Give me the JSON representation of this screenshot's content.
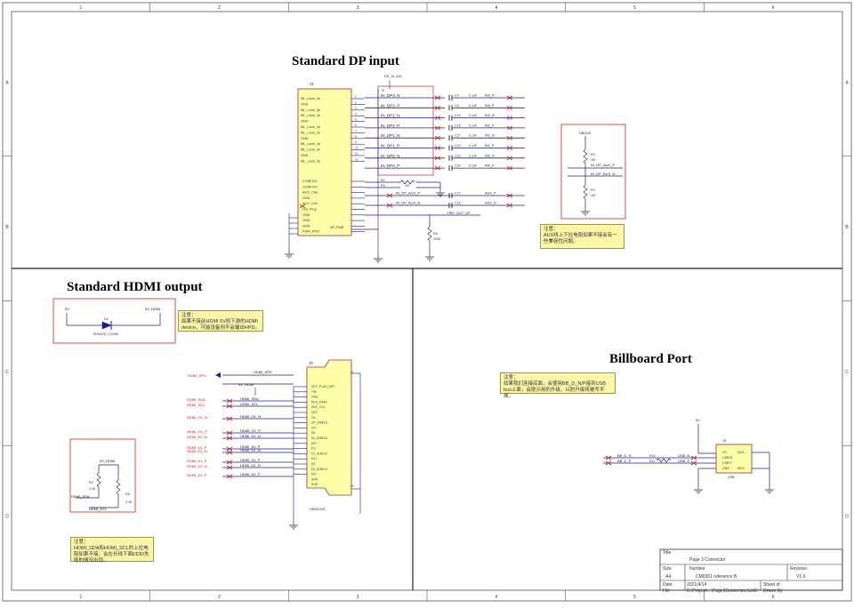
{
  "border_cols": [
    "1",
    "2",
    "3",
    "4",
    "5",
    "6"
  ],
  "border_rows": [
    "A",
    "B",
    "C",
    "D"
  ],
  "sections": {
    "dp": {
      "title": "Standard DP input",
      "connector_ref": "J1",
      "top_net": "DP_In_Det",
      "diff_label": "A",
      "pins_left": [
        "ML_Lane_3n",
        "GND",
        "ML_Lane_3p",
        "ML_Lane_2n",
        "GND",
        "ML_Lane_2p",
        "ML_Lane_1n",
        "GND",
        "ML_Lane_1p",
        "ML_Lane_0n",
        "GND",
        "ML_Lane_0p"
      ],
      "pins_num": [
        "1",
        "2",
        "3",
        "4",
        "5",
        "6",
        "7",
        "8",
        "9",
        "10",
        "11",
        "12"
      ],
      "nets": [
        "IN_DP3_N",
        "IN_DP3_P",
        "IN_DP2_N",
        "IN_DP2_P",
        "IN_DP1_N",
        "IN_DP1_P",
        "IN_DP0_N",
        "IN_DP0_P"
      ],
      "caps": [
        "C4",
        "C3",
        "C19",
        "C18",
        "C27",
        "C24",
        "C23",
        "C20"
      ],
      "cap_values": [
        "0.1uF",
        "0.1uF",
        "0.1uF",
        "0.1uF",
        "0.1uF",
        "0.1uF",
        "0.1uF",
        "0.1uF"
      ],
      "out_nets": [
        "IN3_N",
        "IN3_P",
        "IN2_N",
        "IN2_P",
        "IN1_N",
        "IN1_P",
        "IN0_N",
        "IN0_P"
      ],
      "cfg_pins": [
        "CONFIG1",
        "CONFIG2",
        "AUX_CHp",
        "GND",
        "AUX_CHn",
        "Hot_Plug",
        "GND",
        "GND",
        "GND",
        "PWR_RTN"
      ],
      "aux_nets": [
        "IN_DP_AUX_P",
        "IN_DP_AUX_N",
        "HPD_OUT_DP",
        "DP_PWR"
      ],
      "aux_caps": [
        "C17",
        "C16"
      ],
      "aux_out": [
        "AUX_P",
        "AUX_N"
      ],
      "r_refs": [
        "R4",
        "R5",
        "R6"
      ],
      "r_values": [
        "1M",
        "1M",
        "100K"
      ],
      "aux_box": {
        "net": "VBUS3",
        "r1": "R3",
        "r2": "R3",
        "v1": "1M",
        "v2": "1M",
        "n1": "IN_DP_AUX_P",
        "n2": "IN_DP_AUX_N"
      },
      "note": "注意：\nAUX线上下拉电阻如果不接会有一些兼容性问题。"
    },
    "hdmi": {
      "title": "Standard HDMI output",
      "rail_in": "5V",
      "rail_out": "5V_HDMI",
      "diode_ref": "D4",
      "diode_part": "BSS0HS_CG058",
      "note_top": "注意：\n如果不接此HDMI 5V则下游的HDMI device，可能设备则不会输出HPD。",
      "connector_ref": "J4",
      "connector_part": "HDMI-019",
      "hpd_net": "HDMI_HPD",
      "nets_left": [
        "HDMI_HPD",
        "5V_HDMI",
        "HDMI_SDA",
        "HDMI_SCL",
        "HDMI_CK_N",
        "HDMI_CK_P",
        "HDMI_D0_N",
        "HDMI_D0_P",
        "HDMI_D1_N",
        "HDMI_D1_P",
        "HDMI_D2_N",
        "HDMI_D2_P"
      ],
      "pins": [
        "HOT_PLUG_DET",
        "+5V",
        "GND",
        "DDC_DATA",
        "DDC_CLK",
        "CEC",
        "CK-",
        "CK_SHIELD",
        "CK+",
        "D0-",
        "D0_SHIELD",
        "D0+",
        "D1-",
        "D1_SHIELD",
        "D1+",
        "D2-",
        "D2_SHIELD",
        "D2+",
        "SHD",
        "SHD"
      ],
      "pull_box": {
        "rail": "5V_HDMI",
        "r1": "R9",
        "r2": "R8",
        "v1": "3.3K",
        "v2": "3.3K",
        "n1": "HDMI_SDA",
        "n2": "HDMI_SCL"
      },
      "note_bottom": "注意：\nHDMI_SDA和HDMI_SCL的上拉电阻如果不接，会在长线下面EDID失败的情况出现。"
    },
    "billboard": {
      "title": "Billboard Port",
      "note": "注意：\n如果我们连接底面，会使用BB_D_N/P接到USB bus上面，会提示用的升级，以防升级将被写不掉。",
      "rail": "5V",
      "ic_ref": "J3",
      "ic_part": "USB",
      "ic_pins": [
        "VS",
        "USB M",
        "USB P",
        "GND"
      ],
      "ic_pins_right": [
        "MG1",
        "MG2"
      ],
      "nets": [
        "BB_D_N",
        "BB_D_P"
      ],
      "r_refs": [
        "R10",
        "R11"
      ],
      "out_nets": [
        "USB_N",
        "USB_P"
      ]
    }
  },
  "title_block": {
    "title_label": "Title",
    "title": "Page 3 Connector",
    "size_label": "Size",
    "size": "A4",
    "number_label": "Number",
    "number": "CM0301 reference B",
    "revision_label": "Revision",
    "revision": "V1.0",
    "date_label": "Date",
    "date": "2021/4/14",
    "file_label": "File",
    "file": "D:\\Project\\...\\Page3Connector.SchDoc",
    "sheet_label": "Sheet of",
    "drawn_label": "Drawn By"
  },
  "colors": {
    "wire": "#1b1b9a",
    "part_fill": "#ffffaa",
    "part_stroke": "#a03030",
    "box": "#d04040",
    "net_red": "#cc2020",
    "border": "#555555"
  }
}
